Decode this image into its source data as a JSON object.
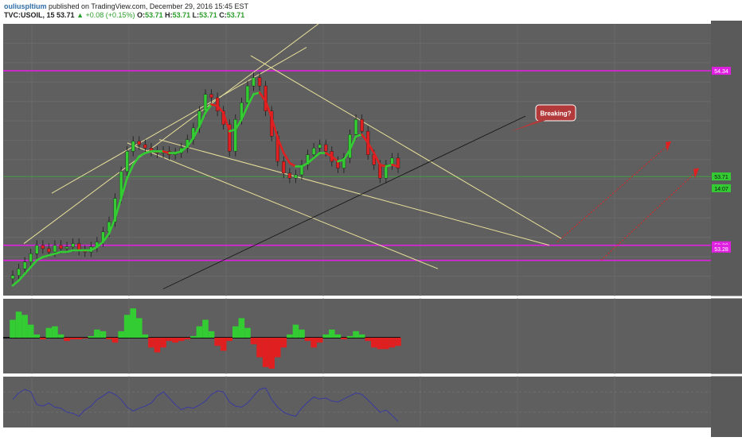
{
  "header": {
    "author": "ouliuspltium",
    "published": "published on TradingView.com, December 29, 2016 15:45 EST",
    "symbol": "TVC:USOIL, 15",
    "last": "53.71",
    "change": "+0.08 (+0.15%)",
    "open_label": "O:",
    "open": "53.71",
    "high_label": "H:",
    "high": "53.71",
    "low_label": "L:",
    "low": "53.71",
    "close_label": "C:",
    "close": "53.71"
  },
  "annotation": {
    "text": "Breaking?"
  },
  "colors": {
    "background": "#5f5f5f",
    "magenta": "#e020e0",
    "green": "#33cc33",
    "red": "#e02020",
    "trend": "#e8e09a",
    "support": "#111111",
    "rsi": "#3a3aa0"
  },
  "chart_data": {
    "type": "line",
    "price_labels": [
      {
        "value": 54.34,
        "label": "54.34",
        "color": "#e020e0"
      },
      {
        "value": 53.71,
        "label": "53.71",
        "color": "#33cc33"
      },
      {
        "value": 53.64,
        "label": "14:07",
        "color": "#33cc33"
      },
      {
        "value": 53.3,
        "label": "53.30",
        "color": "#e020e0"
      },
      {
        "value": 53.28,
        "label": "53.28",
        "color": "#e020e0"
      }
    ],
    "horizontal_levels": [
      54.34,
      53.3,
      53.21
    ],
    "ylim": [
      53.0,
      54.62
    ],
    "price_series": {
      "name": "",
      "values": [
        53.12,
        53.16,
        53.2,
        53.25,
        53.3,
        53.28,
        53.26,
        53.3,
        53.28,
        53.29,
        53.31,
        53.27,
        53.26,
        53.29,
        53.32,
        53.38,
        53.44,
        53.58,
        53.74,
        53.86,
        53.92,
        53.9,
        53.88,
        53.86,
        53.85,
        53.86,
        53.84,
        53.85,
        53.88,
        53.93,
        54.0,
        54.1,
        54.2,
        54.18,
        54.1,
        54.02,
        53.86,
        54.05,
        54.15,
        54.25,
        54.3,
        54.25,
        54.1,
        53.95,
        53.8,
        53.73,
        53.7,
        53.72,
        53.78,
        53.84,
        53.88,
        53.9,
        53.86,
        53.8,
        53.76,
        53.82,
        53.96,
        54.05,
        53.98,
        53.84,
        53.78,
        53.7,
        53.78,
        53.82,
        53.76
      ]
    },
    "moving_average": {
      "name": "",
      "values": [
        53.06,
        53.09,
        53.13,
        53.17,
        53.21,
        53.23,
        53.24,
        53.25,
        53.26,
        53.26,
        53.27,
        53.27,
        53.27,
        53.27,
        53.29,
        53.32,
        53.37,
        53.46,
        53.58,
        53.7,
        53.78,
        53.83,
        53.85,
        53.86,
        53.86,
        53.86,
        53.85,
        53.85,
        53.86,
        53.89,
        53.94,
        54.01,
        54.09,
        54.14,
        54.13,
        54.09,
        53.98,
        53.99,
        54.05,
        54.13,
        54.2,
        54.21,
        54.16,
        54.06,
        53.94,
        53.85,
        53.79,
        53.77,
        53.77,
        53.79,
        53.82,
        53.85,
        53.85,
        53.83,
        53.8,
        53.81,
        53.87,
        53.95,
        53.96,
        53.91,
        53.85,
        53.78,
        53.77,
        53.78,
        53.77
      ]
    },
    "histogram": {
      "name": "",
      "values": [
        0.55,
        0.8,
        0.7,
        0.4,
        0.1,
        -0.05,
        0.3,
        0.35,
        0.1,
        -0.1,
        -0.05,
        -0.05,
        -0.02,
        0.05,
        0.25,
        0.2,
        -0.05,
        -0.15,
        0.2,
        0.7,
        0.9,
        0.6,
        0.1,
        -0.3,
        -0.45,
        -0.3,
        -0.1,
        -0.15,
        -0.1,
        -0.05,
        0.05,
        0.35,
        0.55,
        0.2,
        -0.25,
        -0.4,
        -0.1,
        0.35,
        0.6,
        0.3,
        -0.2,
        -0.6,
        -0.9,
        -0.95,
        -0.6,
        -0.3,
        0.1,
        0.4,
        0.25,
        -0.1,
        -0.3,
        -0.15,
        0.1,
        0.25,
        0.1,
        -0.05,
        0.05,
        0.2,
        0.1,
        -0.1,
        -0.3,
        -0.35,
        -0.35,
        -0.3,
        -0.25
      ],
      "ylim": [
        -1,
        1
      ]
    },
    "oscillator": {
      "name": "",
      "values": [
        55,
        68,
        75,
        70,
        45,
        42,
        48,
        40,
        38,
        30,
        28,
        22,
        35,
        42,
        55,
        62,
        70,
        65,
        55,
        40,
        32,
        38,
        42,
        48,
        62,
        70,
        58,
        45,
        35,
        40,
        38,
        44,
        52,
        65,
        72,
        70,
        50,
        42,
        40,
        48,
        62,
        75,
        78,
        55,
        40,
        30,
        25,
        22,
        38,
        50,
        60,
        56,
        58,
        52,
        50,
        56,
        62,
        68,
        65,
        54,
        42,
        30,
        34,
        24,
        12
      ],
      "ylim": [
        0,
        100
      ]
    },
    "grid": true
  }
}
